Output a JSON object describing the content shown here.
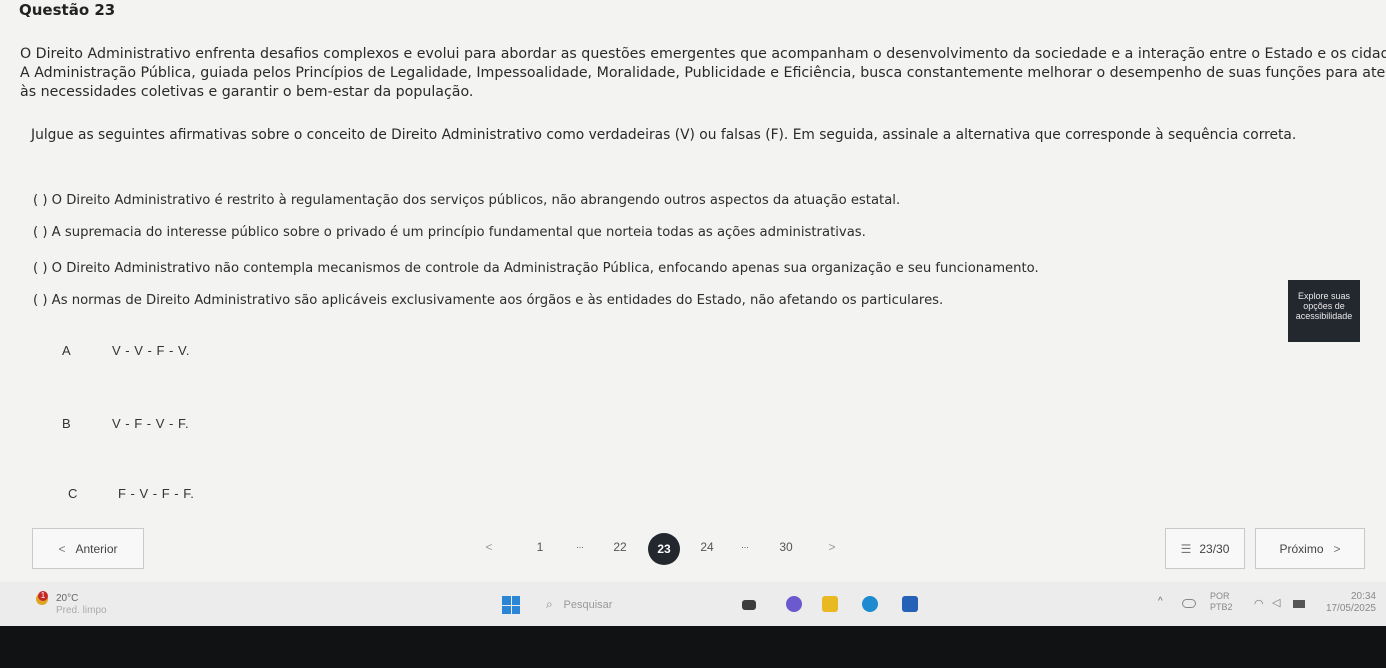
{
  "question": {
    "title": "Questão 23",
    "intro_lines": [
      "O Direito Administrativo enfrenta desafios complexos e evolui para abordar as questões emergentes que acompanham o desenvolvimento da sociedade e a interação entre o Estado e os cidadãos.",
      "A Administração Pública, guiada pelos Princípios de Legalidade, Impessoalidade, Moralidade, Publicidade e Eficiência, busca constantemente melhorar o desempenho de suas funções para atender",
      "às necessidades coletivas e garantir o bem-estar da população."
    ],
    "instruction": "Julgue as seguintes afirmativas sobre o conceito de Direito Administrativo como verdadeiras (V) ou falsas (F). Em seguida, assinale a alternativa que corresponde à sequência correta.",
    "statements": [
      "( ) O Direito Administrativo é restrito à regulamentação dos serviços públicos, não abrangendo outros aspectos da atuação estatal.",
      "( ) A supremacia do interesse público sobre o privado é um princípio fundamental que norteia todas as ações administrativas.",
      "( ) O Direito Administrativo não contempla mecanismos de controle da Administração Pública, enfocando apenas sua organização e seu funcionamento.",
      "( ) As normas de Direito Administrativo são aplicáveis exclusivamente aos órgãos e às entidades do Estado, não afetando os particulares."
    ],
    "options": [
      {
        "letter": "A",
        "text": "V - V - F - V."
      },
      {
        "letter": "B",
        "text": "V - F - V - F."
      },
      {
        "letter": "C",
        "text": "F - V - F - F."
      }
    ]
  },
  "accessibility": {
    "line1": "Explore suas",
    "line2": "opções de",
    "line3": "acessibilidade"
  },
  "nav": {
    "prev_label": "Anterior",
    "next_label": "Próximo",
    "pages": [
      "1",
      "...",
      "22",
      "24",
      "...",
      "30"
    ],
    "current_page": "23",
    "progress": "23/30",
    "prev_arrow": "<",
    "next_arrow": ">"
  },
  "taskbar": {
    "weather_temp": "20°C",
    "weather_desc": "Pred. limpo",
    "weather_badge": "1",
    "search_placeholder": "Pesquisar",
    "lang_line1": "POR",
    "lang_line2": "PTB2",
    "time": "20:34",
    "date": "17/05/2025"
  }
}
